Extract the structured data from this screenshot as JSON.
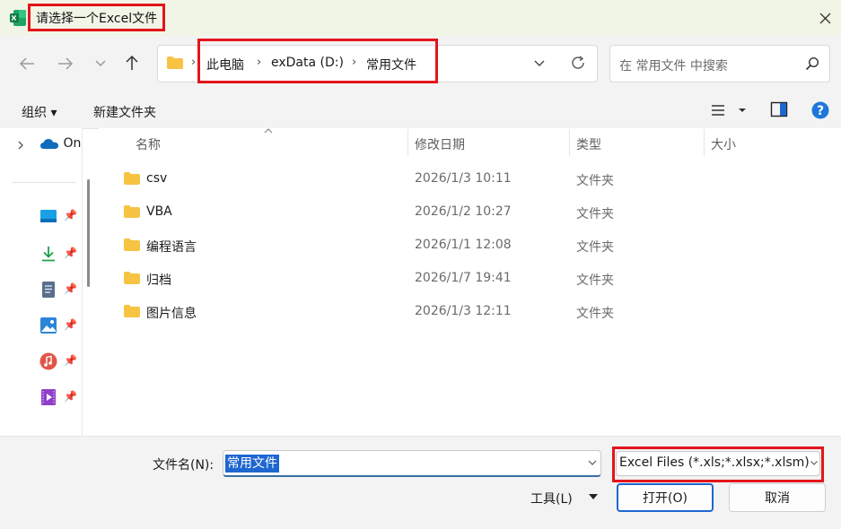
{
  "window": {
    "title": "请选择一个Excel文件",
    "app_icon": "excel-icon"
  },
  "nav_buttons": [
    "back-arrow-icon",
    "forward-arrow-icon",
    "chevron-down-icon",
    "up-arrow-icon"
  ],
  "address": {
    "breadcrumbs": [
      "此电脑",
      "exData (D:)",
      "常用文件"
    ],
    "separator": "›"
  },
  "search": {
    "placeholder": "在 常用文件 中搜索"
  },
  "commands": {
    "organize": "组织 ▾",
    "new_folder": "新建文件夹"
  },
  "sidebar": {
    "onedrive_label": "On",
    "items": [
      {
        "icon": "desktop-icon",
        "color": "#1aa0e6"
      },
      {
        "icon": "download-icon",
        "color": "#1aa34a"
      },
      {
        "icon": "documents-icon",
        "color": "#5a6f8c"
      },
      {
        "icon": "pictures-icon",
        "color": "#2a86d6"
      },
      {
        "icon": "music-icon",
        "color": "#e2564a"
      },
      {
        "icon": "videos-icon",
        "color": "#8f3fc9"
      }
    ]
  },
  "table": {
    "headers": {
      "name": "名称",
      "date": "修改日期",
      "type": "类型",
      "size": "大小"
    },
    "rows": [
      {
        "name": "csv",
        "date": "2026/1/3 10:11",
        "type": "文件夹"
      },
      {
        "name": "VBA",
        "date": "2026/1/2 10:27",
        "type": "文件夹"
      },
      {
        "name": "编程语言",
        "date": "2026/1/1 12:08",
        "type": "文件夹"
      },
      {
        "name": "归档",
        "date": "2026/1/7 19:41",
        "type": "文件夹"
      },
      {
        "name": "图片信息",
        "date": "2026/1/3 12:11",
        "type": "文件夹"
      }
    ]
  },
  "footer": {
    "filename_label": "文件名(N):",
    "filename_value": "常用文件",
    "filetype_value": "Excel Files (*.xls;*.xlsx;*.xlsm)",
    "tools_label": "工具(L)",
    "open_label": "打开(O)",
    "cancel_label": "取消"
  },
  "colors": {
    "highlight_border": "#e3151a",
    "folder": "#f6c343",
    "accent": "#1e66d0"
  }
}
